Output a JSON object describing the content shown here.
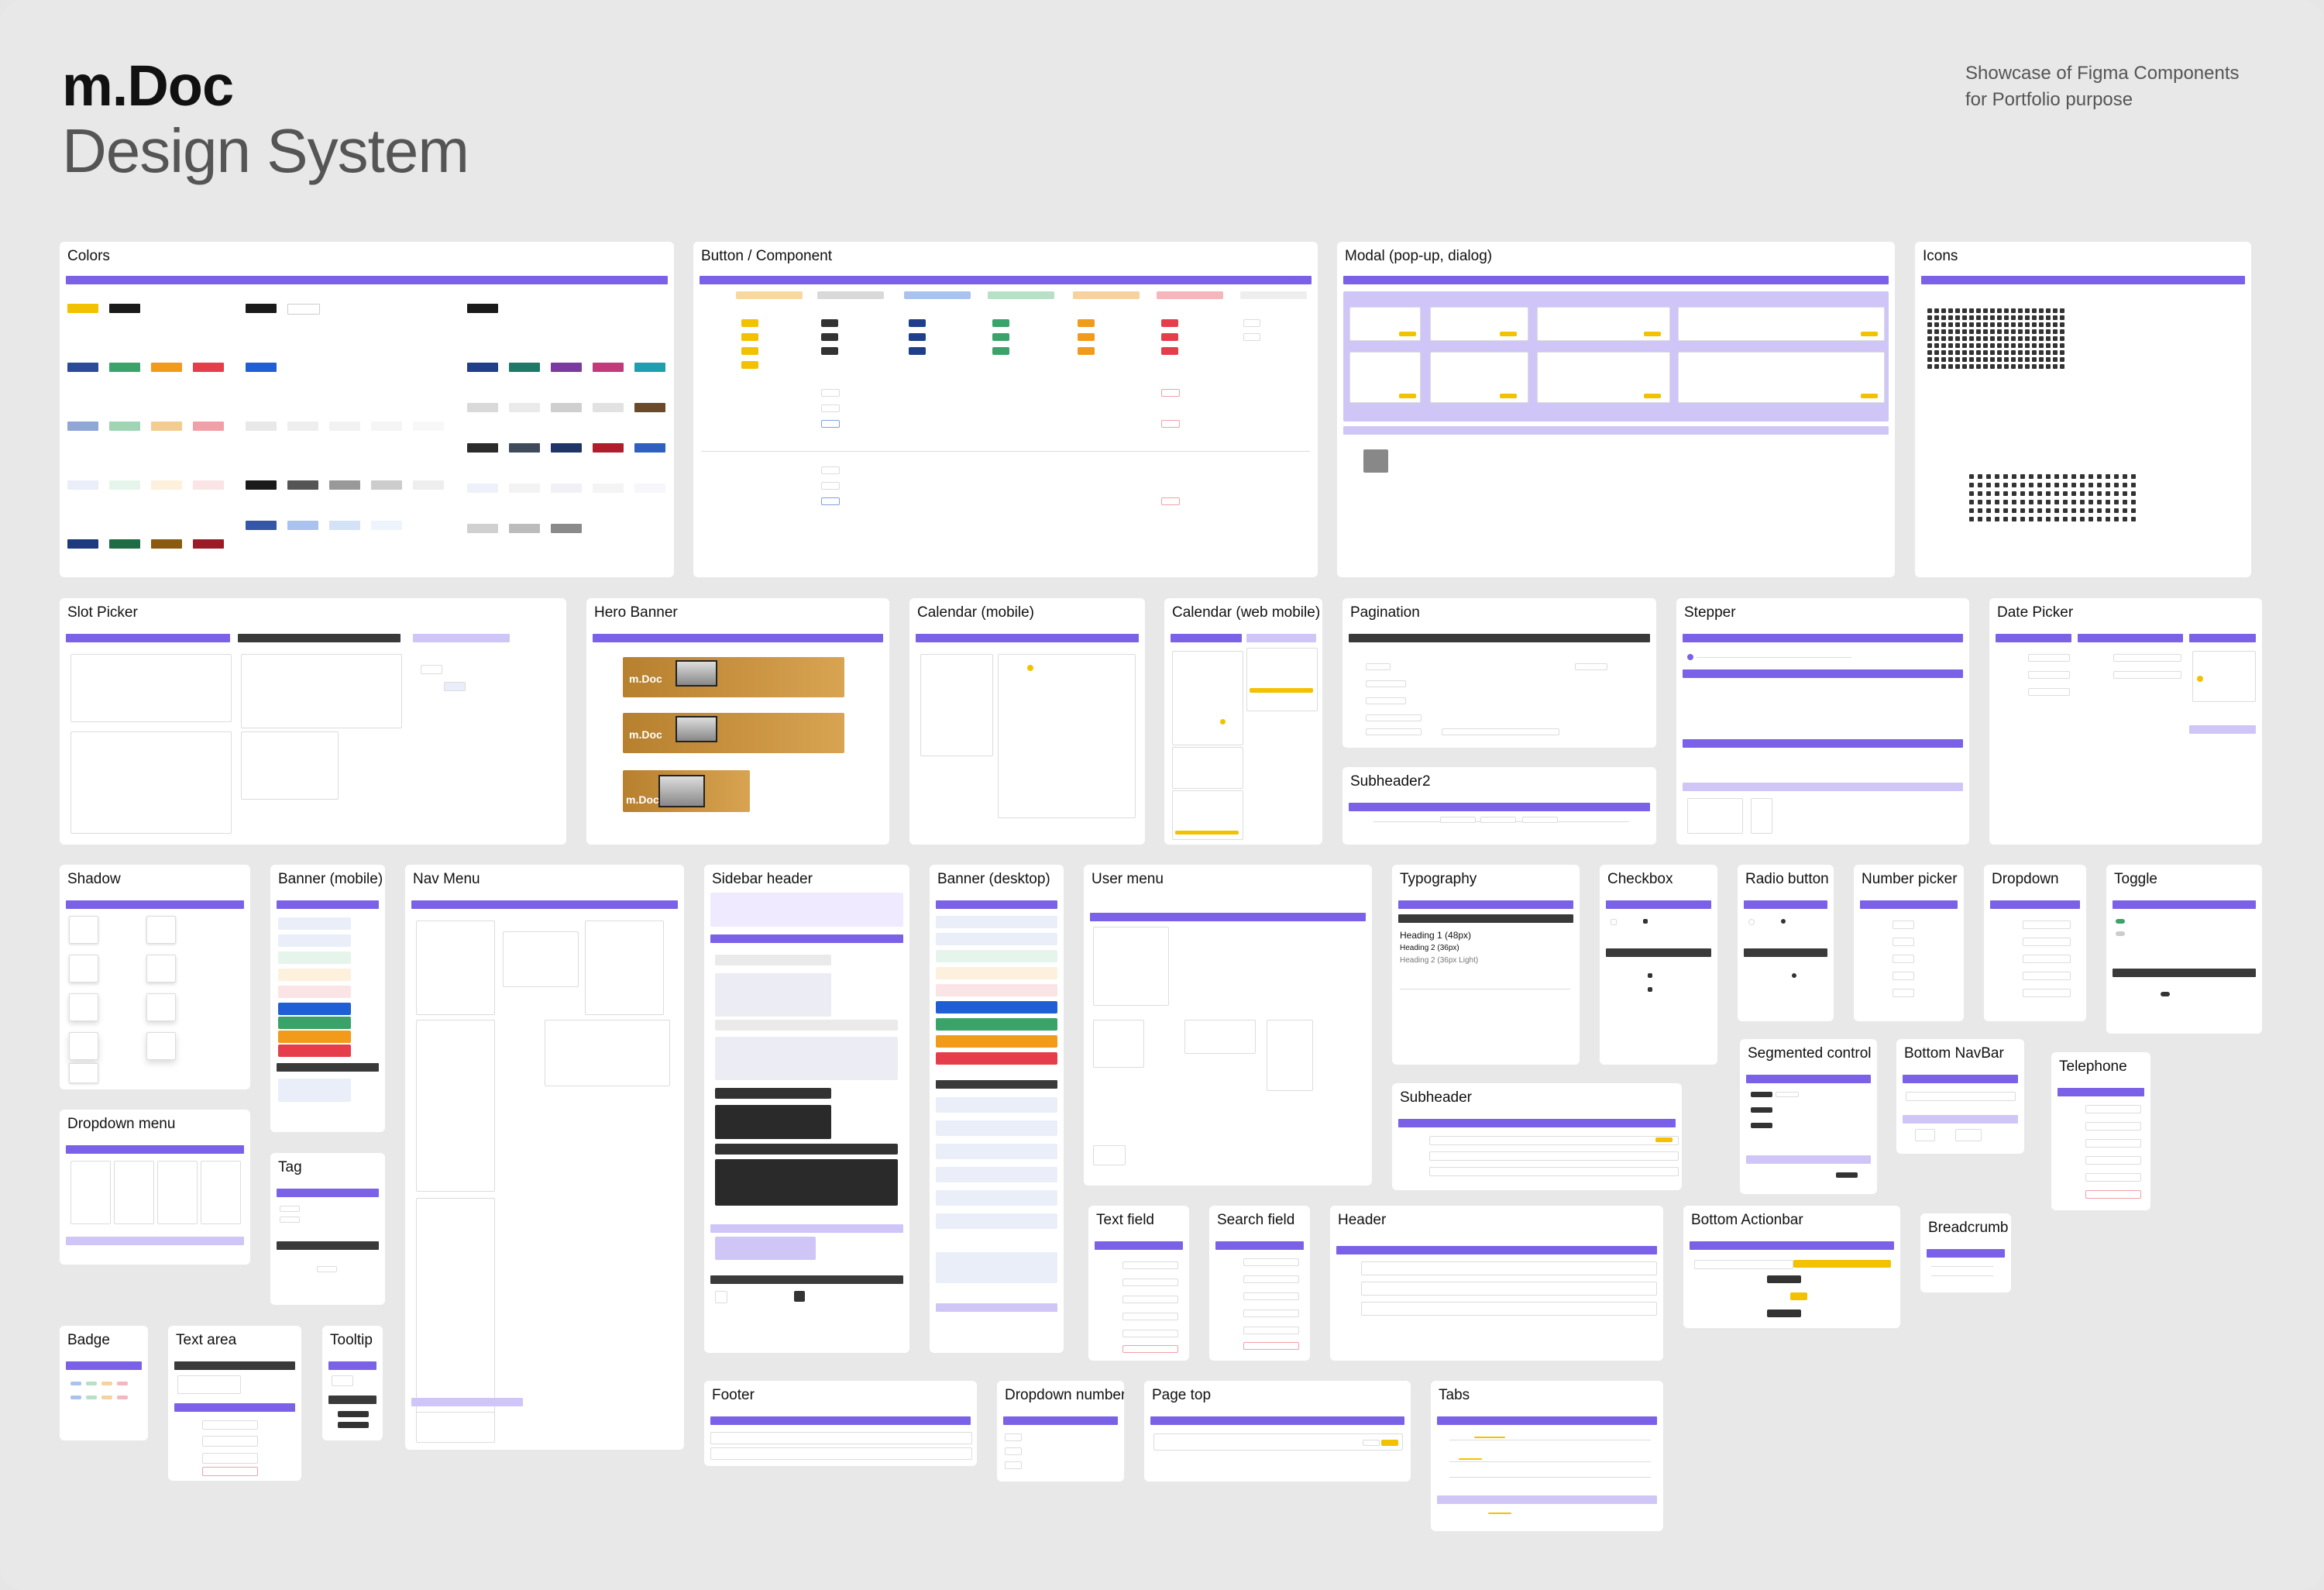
{
  "header": {
    "brand_line1": "m.Doc",
    "brand_line2": "Design System",
    "showcase_line1": "Showcase of Figma Components",
    "showcase_line2": "for Portfolio purpose"
  },
  "sections": {
    "colors": "Colors",
    "button_component": "Button / Component",
    "modal": "Modal (pop-up, dialog)",
    "icons": "Icons",
    "slot_picker": "Slot Picker",
    "hero_banner": "Hero Banner",
    "calendar_mobile": "Calendar (mobile)",
    "calendar_web_mobile": "Calendar (web mobile)",
    "pagination": "Pagination",
    "stepper": "Stepper",
    "date_picker": "Date Picker",
    "subheader2": "Subheader2",
    "shadow": "Shadow",
    "banner_mobile": "Banner (mobile)",
    "nav_menu": "Nav Menu",
    "sidebar_header": "Sidebar header",
    "banner_desktop": "Banner (desktop)",
    "user_menu": "User menu",
    "typography": "Typography",
    "checkbox": "Checkbox",
    "radio_button": "Radio button",
    "number_picker": "Number picker",
    "dropdown": "Dropdown",
    "toggle": "Toggle",
    "segmented_control": "Segmented control",
    "bottom_navbar": "Bottom NavBar",
    "telephone": "Telephone",
    "subheader": "Subheader",
    "dropdown_menu": "Dropdown menu",
    "tag": "Tag",
    "text_field": "Text field",
    "search_field": "Search field",
    "header": "Header",
    "bottom_actionbar": "Bottom Actionbar",
    "breadcrumb": "Breadcrumb",
    "badge": "Badge",
    "text_area": "Text area",
    "tooltip": "Tooltip",
    "footer": "Footer",
    "dropdown_number": "Dropdown number",
    "page_top": "Page top",
    "tabs": "Tabs"
  },
  "hero_banner": {
    "logo": "m.Doc"
  },
  "typography": {
    "heading1": "Heading 1 (48px)",
    "heading2": "Heading 2 (36px)",
    "heading2_light": "Heading 2 (36px Light)"
  },
  "colors": {
    "brand_yellow": "#f2c200",
    "black": "#1a1a1a",
    "accent": "#7b61e8",
    "blue": "#1f5fd6",
    "green": "#3aa36a",
    "orange": "#f29a1a",
    "red": "#e53d4a"
  }
}
